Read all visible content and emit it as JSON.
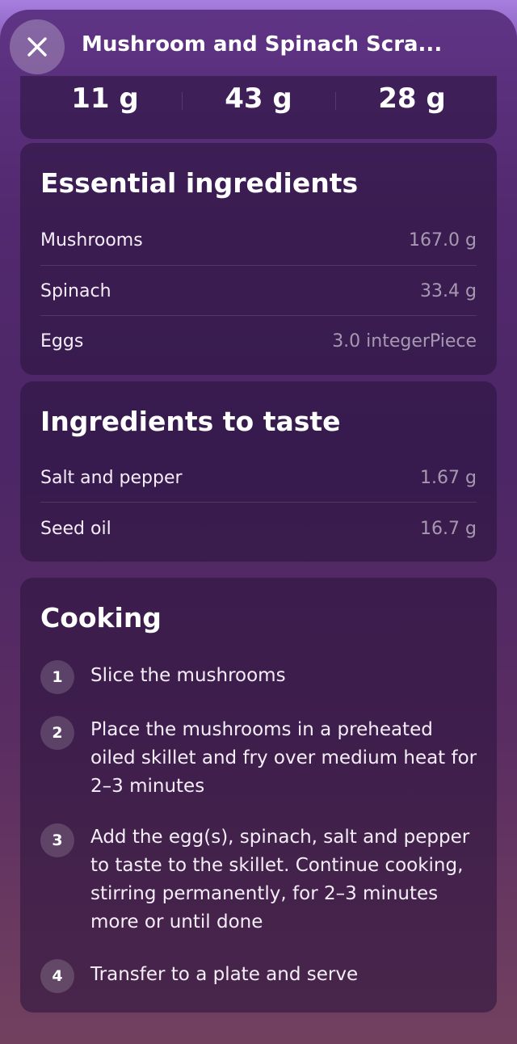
{
  "header": {
    "title": "Mushroom and Spinach Scra..."
  },
  "macros": [
    "11 g",
    "43 g",
    "28 g"
  ],
  "essential": {
    "title": "Essential ingredients",
    "items": [
      {
        "name": "Mushrooms",
        "qty": "167.0 g"
      },
      {
        "name": "Spinach",
        "qty": "33.4 g"
      },
      {
        "name": "Eggs",
        "qty": "3.0 integerPiece"
      }
    ]
  },
  "to_taste": {
    "title": "Ingredients to taste",
    "items": [
      {
        "name": "Salt and pepper",
        "qty": "1.67 g"
      },
      {
        "name": "Seed oil",
        "qty": "16.7 g"
      }
    ]
  },
  "cooking": {
    "title": "Cooking",
    "steps": [
      {
        "num": "1",
        "text": "Slice the mushrooms"
      },
      {
        "num": "2",
        "text": "Place the mushrooms in a preheated oiled skillet and fry over medium heat for 2–3 minutes"
      },
      {
        "num": "3",
        "text": "Add the egg(s), spinach, salt and pepper to taste to the skillet. Continue cooking, stirring permanently, for 2–3 minutes more or until done"
      },
      {
        "num": "4",
        "text": "Transfer to a plate and serve"
      }
    ]
  }
}
